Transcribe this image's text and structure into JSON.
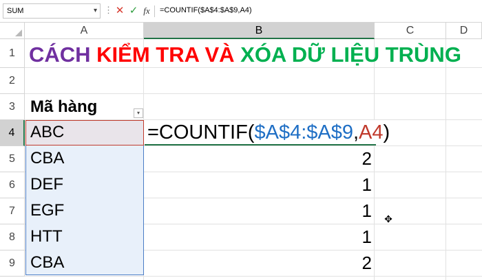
{
  "formula_bar": {
    "name_box": "SUM",
    "name_box_dropdown": "▾",
    "more": "⋮",
    "cancel": "✕",
    "enter": "✓",
    "fx": "fx",
    "formula": "=COUNTIF($A$4:$A$9,A4)"
  },
  "columns": [
    "A",
    "B",
    "C",
    "D"
  ],
  "rows": [
    "1",
    "2",
    "3",
    "4",
    "5",
    "6",
    "7",
    "8",
    "9"
  ],
  "title": {
    "part1": "CÁCH ",
    "part2": "KIỂM TRA VÀ ",
    "part3": "XÓA DỮ LIỆU TRÙNG",
    "colors": {
      "part1": "#7030a0",
      "part2": "#ff0000",
      "part3": "#00b050"
    }
  },
  "header_label": "Mã hàng",
  "filter_icon": "▾",
  "column_a": [
    "ABC",
    "CBA",
    "DEF",
    "EGF",
    "HTT",
    "CBA"
  ],
  "formula_cell": {
    "prefix": "=COUNTIF(",
    "range": "$A$4:$A$9",
    "comma": ",",
    "ref": "A4",
    "suffix": ")",
    "range_color": "#1f6fc5",
    "ref_color": "#c0392b"
  },
  "column_b": [
    "2",
    "1",
    "1",
    "1",
    "2"
  ],
  "cursor": "✥"
}
